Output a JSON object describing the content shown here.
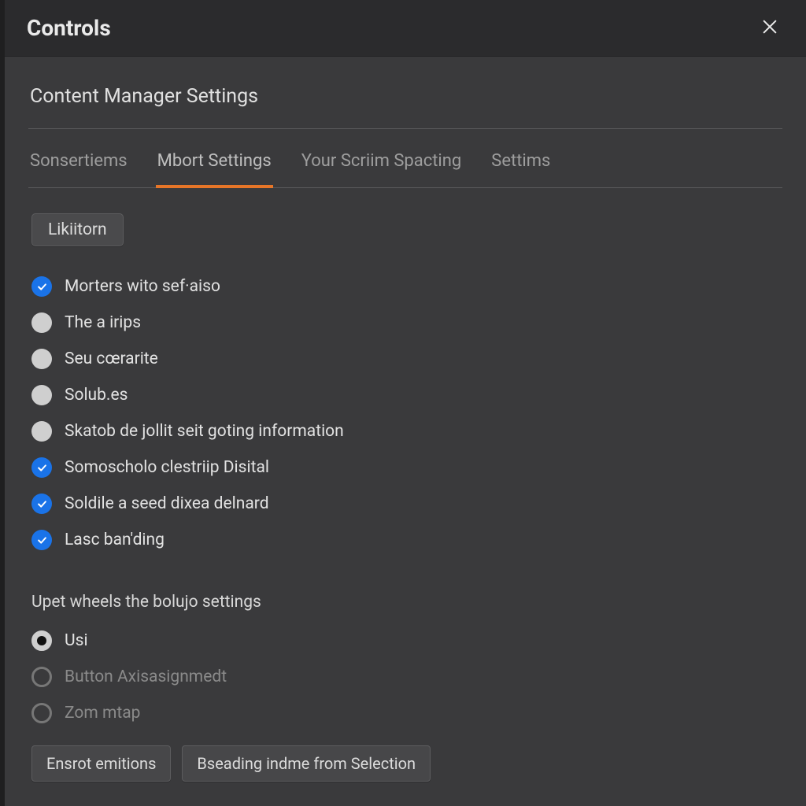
{
  "window": {
    "title": "Controls"
  },
  "page": {
    "subtitle": "Content Manager Settings"
  },
  "tabs": [
    {
      "id": "sonsertiems",
      "label": "Sonsertiems",
      "active": false
    },
    {
      "id": "mbort-settings",
      "label": "Mbort Settings",
      "active": true
    },
    {
      "id": "your-scriim-spacting",
      "label": "Your Scriim Spacting",
      "active": false
    },
    {
      "id": "settims",
      "label": "Settims",
      "active": false
    }
  ],
  "mainButton": {
    "label": "Likiitorn"
  },
  "options": [
    {
      "id": "opt-morters",
      "type": "checkbox",
      "checked": true,
      "label": "Morters wito sef·aiso"
    },
    {
      "id": "opt-irips",
      "type": "radio",
      "checked": false,
      "label": "The a irips"
    },
    {
      "id": "opt-seu",
      "type": "radio",
      "checked": false,
      "label": "Seu cœrarite"
    },
    {
      "id": "opt-solub",
      "type": "radio",
      "checked": false,
      "label": "Solub.es"
    },
    {
      "id": "opt-skatob",
      "type": "radio",
      "checked": false,
      "label": "Skatob de jollit seit goting information"
    },
    {
      "id": "opt-somos",
      "type": "checkbox",
      "checked": true,
      "label": "Somoscholo clestriip Disital"
    },
    {
      "id": "opt-soldile",
      "type": "checkbox",
      "checked": true,
      "label": "Soldile a seed dixea delnard"
    },
    {
      "id": "opt-lasc",
      "type": "checkbox",
      "checked": true,
      "label": "Lasc ban'ding"
    }
  ],
  "radioSection": {
    "heading": "Upet wheels the bolujo settings",
    "items": [
      {
        "id": "r-usi",
        "label": "Usi",
        "selected": true,
        "disabled": false
      },
      {
        "id": "r-button-axis",
        "label": "Button Axisasignmedt",
        "selected": false,
        "disabled": true
      },
      {
        "id": "r-zom-mtap",
        "label": "Zom mtap",
        "selected": false,
        "disabled": true
      }
    ]
  },
  "footerButtons": [
    {
      "id": "btn-ensrot",
      "label": "Ensrot emitions"
    },
    {
      "id": "btn-bseading",
      "label": "Bseading indme from Selection"
    }
  ]
}
